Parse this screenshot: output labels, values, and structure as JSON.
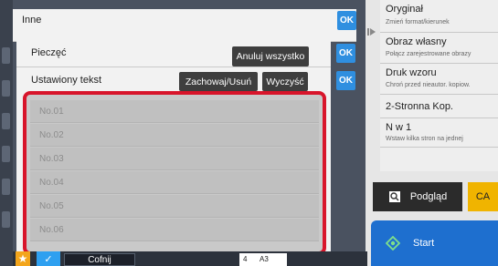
{
  "header": {
    "title": "Inne",
    "ok_label": "OK"
  },
  "stamp": {
    "label": "Pieczęć",
    "cancel_all": "Anuluj wszystko",
    "ok_label": "OK"
  },
  "preset_text": {
    "label": "Ustawiony tekst",
    "save_delete": "Zachowaj/Usuń",
    "clear": "Wyczyść",
    "ok_label": "OK"
  },
  "list": {
    "items": [
      "No.01",
      "No.02",
      "No.03",
      "No.04",
      "No.05",
      "No.06"
    ]
  },
  "right_menu": {
    "items": [
      {
        "title": "Oryginał",
        "sub": "Zmień format/kierunek"
      },
      {
        "title": "Obraz własny",
        "sub": "Połącz zarejestrowane obrazy"
      },
      {
        "title": "Druk wzoru",
        "sub": "Chroń przed nieautor. kopiow."
      },
      {
        "title": "2-Stronna Kop.",
        "sub": ""
      },
      {
        "title": "N w 1",
        "sub": "Wstaw kilka stron na jednej"
      }
    ]
  },
  "actions": {
    "preview": "Podgląd",
    "ca": "CA",
    "start": "Start"
  },
  "bottom": {
    "back": "Cofnij",
    "paper_num": "4",
    "paper_size": "A3"
  },
  "colors": {
    "accent": "#2f8fe0",
    "highlight": "#d8152b",
    "start": "#1e6fcf",
    "ca": "#f0b400"
  }
}
